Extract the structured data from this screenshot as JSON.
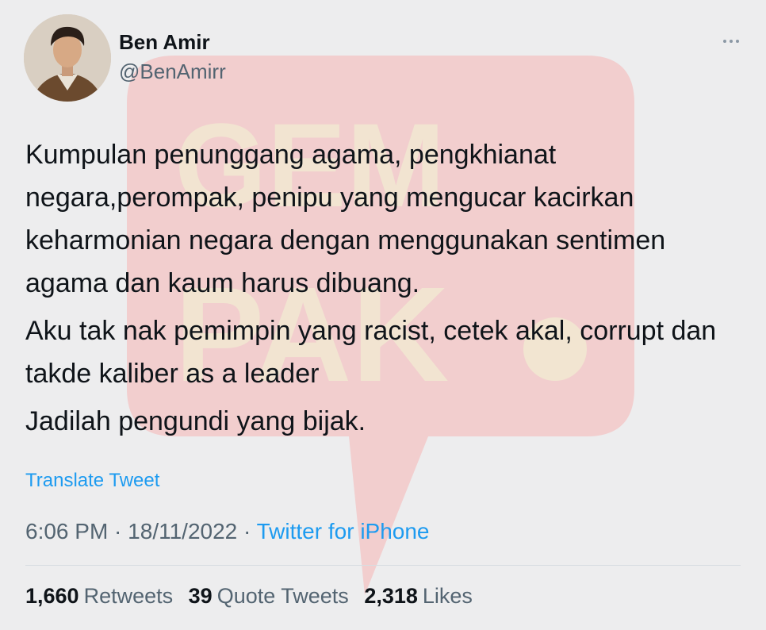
{
  "author": {
    "name": "Ben Amir",
    "handle": "@BenAmirr"
  },
  "tweet": {
    "paragraphs": [
      "Kumpulan penunggang agama, pengkhianat negara,perompak, penipu yang mengucar kacirkan keharmonian negara dengan menggunakan sentimen agama dan kaum harus dibuang.",
      "Aku tak nak pemimpin yang racist, cetek akal, corrupt dan takde kaliber as a leader",
      "Jadilah pengundi yang bijak."
    ],
    "translate_label": "Translate Tweet"
  },
  "meta": {
    "time": "6:06 PM",
    "separator": " · ",
    "date": "18/11/2022",
    "source": "Twitter for iPhone"
  },
  "stats": {
    "retweets_count": "1,660",
    "retweets_label": "Retweets",
    "quotes_count": "39",
    "quotes_label": "Quote Tweets",
    "likes_count": "2,318",
    "likes_label": "Likes"
  },
  "watermark": {
    "text": "GEMPAK"
  },
  "colors": {
    "background": "#ededee",
    "link": "#1d9bf0",
    "text": "#0f1419",
    "secondary": "#536471",
    "watermark_red": "#f4a9a9",
    "watermark_yellow": "#f0e4c4"
  },
  "icons": {
    "more": "more-horizontal-icon"
  }
}
